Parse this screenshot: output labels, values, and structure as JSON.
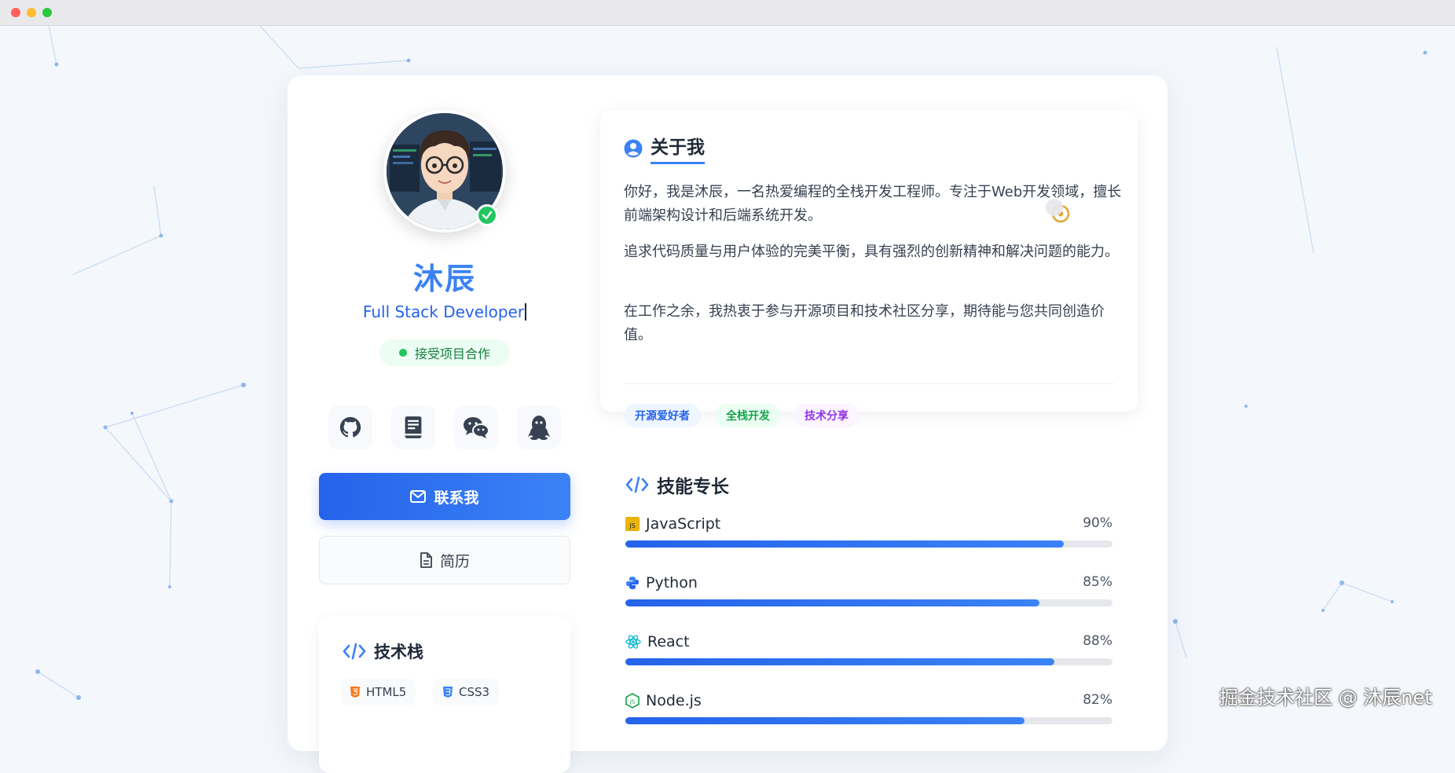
{
  "profile": {
    "name": "沐辰",
    "role": "Full Stack Developer",
    "status": "接受项目合作"
  },
  "socials": [
    {
      "icon": "github-icon"
    },
    {
      "icon": "book-icon"
    },
    {
      "icon": "wechat-icon"
    },
    {
      "icon": "qq-icon"
    }
  ],
  "actions": {
    "contact": "联系我",
    "resume": "简历"
  },
  "tech_stack": {
    "title": "技术栈",
    "items": [
      "HTML5",
      "CSS3"
    ]
  },
  "about": {
    "title": "关于我",
    "paragraphs": [
      "你好，我是沐辰，一名热爱编程的全栈开发工程师。专注于Web开发领域，擅长前端架构设计和后端系统开发。",
      "追求代码质量与用户体验的完美平衡，具有强烈的创新精神和解决问题的能力。",
      "在工作之余，我热衷于参与开源项目和技术社区分享，期待能与您共同创造价值。"
    ],
    "tags": [
      "开源爱好者",
      "全栈开发",
      "技术分享"
    ]
  },
  "skills": {
    "title": "技能专长",
    "items": [
      {
        "name": "JavaScript",
        "percent": "90%",
        "value": 0.9,
        "icon": "javascript-icon"
      },
      {
        "name": "Python",
        "percent": "85%",
        "value": 0.85,
        "icon": "python-icon"
      },
      {
        "name": "React",
        "percent": "88%",
        "value": 0.88,
        "icon": "react-icon"
      },
      {
        "name": "Node.js",
        "percent": "82%",
        "value": 0.82,
        "icon": "nodejs-icon"
      }
    ]
  },
  "watermark": "掘金技术社区 @ 沐辰net",
  "colors": {
    "accent": "#3b82f6",
    "status_green": "#22c55e"
  }
}
